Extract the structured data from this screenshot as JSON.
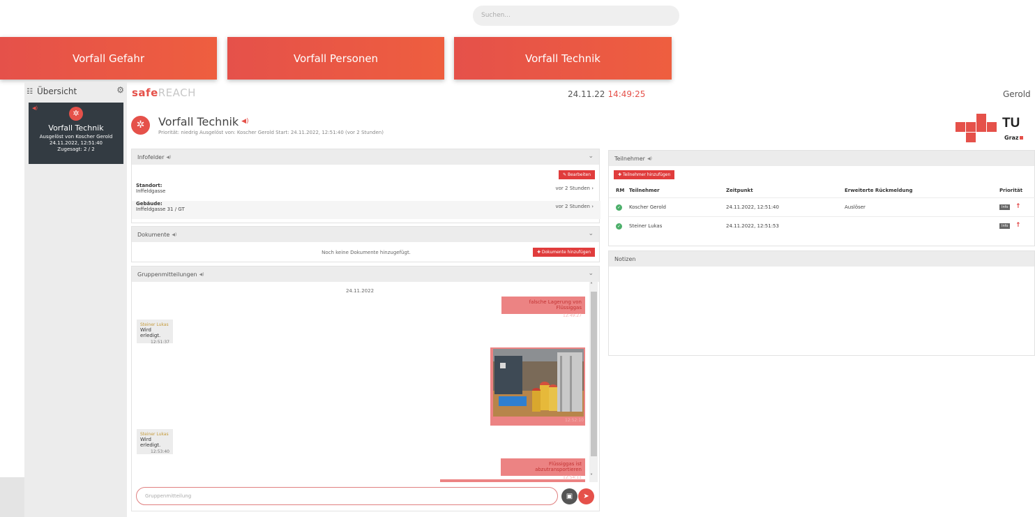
{
  "search": {
    "placeholder": "Suchen..."
  },
  "top_buttons": [
    "Vorfall Gefahr",
    "Vorfall Personen",
    "Vorfall Technik"
  ],
  "sidebar": {
    "title": "Übersicht",
    "card": {
      "title": "Vorfall Technik",
      "triggered_by": "Ausgelöst von Koscher Gerold",
      "datetime": "24.11.2022, 12:51:40",
      "confirmed": "Zugesagt: 2 / 2"
    }
  },
  "brand": {
    "bold": "safe",
    "light": "REACH"
  },
  "clock": {
    "date": "24.11.22",
    "time": "14:49:25"
  },
  "user": {
    "name": "Gerold"
  },
  "incident": {
    "title": "Vorfall Technik",
    "subtitle": "Priorität: niedrig   Ausgelöst von: Koscher Gerold   Start: 24.11.2022, 12:51:40 (vor 2 Stunden)"
  },
  "logo": {
    "text": "TU",
    "sub": "Graz"
  },
  "infofelder": {
    "title": "Infofelder",
    "edit_label": "Bearbeiten",
    "fields": [
      {
        "label": "Standort:",
        "value": "Inffeldgasse",
        "when": "vor 2 Stunden"
      },
      {
        "label": "Gebäude:",
        "value": "Inffeldgasse 31 / GT",
        "when": "vor 2 Stunden"
      }
    ]
  },
  "dokumente": {
    "title": "Dokumente",
    "empty": "Noch keine Dokumente hinzugefügt.",
    "add_label": "Dokumente hinzufügen"
  },
  "chat": {
    "title": "Gruppenmitteilungen",
    "date": "24.11.2022",
    "messages": [
      {
        "text": "falsche Lagerung von Flüssiggas",
        "time": "12:49:27"
      },
      {
        "sender": "Steiner Lukas",
        "text": "Wird erledigt.",
        "time": "12:51:37"
      },
      {
        "time": "12:52:10"
      },
      {
        "sender": "Steiner Lukas",
        "text": "Wird erledigt.",
        "time": "12:53:40"
      },
      {
        "text": "Flüssiggas ist abzutransportieren",
        "time": "12:54:11"
      }
    ],
    "input_placeholder": "Gruppenmitteilung"
  },
  "teilnehmer": {
    "title": "Teilnehmer",
    "add_label": "Teilnehmer hinzufügen",
    "columns": [
      "RM",
      "Teilnehmer",
      "Zeitpunkt",
      "Erweiterte Rückmeldung",
      "Priorität"
    ],
    "rows": [
      {
        "name": "Koscher Gerold",
        "time": "24.11.2022, 12:51:40",
        "feedback": "Auslöser",
        "badge": "Info"
      },
      {
        "name": "Steiner Lukas",
        "time": "24.11.2022, 12:51:53",
        "feedback": "",
        "badge": "Info"
      }
    ]
  },
  "notizen": {
    "title": "Notizen"
  },
  "colors": {
    "accent": "#e5514a",
    "dark_card": "#333b42",
    "ok": "#4caf6a"
  }
}
